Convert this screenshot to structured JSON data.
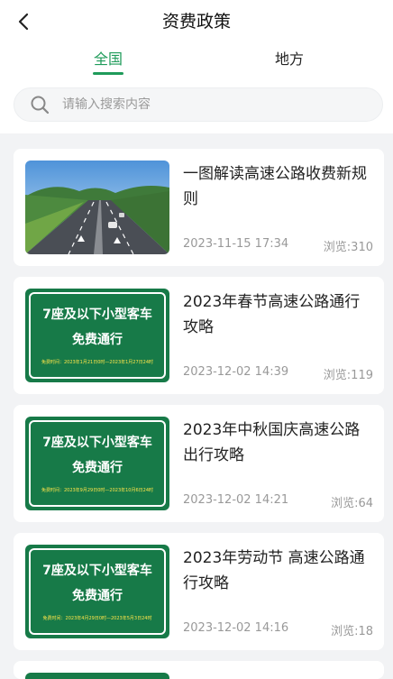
{
  "header": {
    "back_icon": "chevron-left-icon",
    "title": "资费政策"
  },
  "tabs": {
    "items": [
      {
        "label": "全国",
        "active": true
      },
      {
        "label": "地方",
        "active": false
      }
    ],
    "accent_color": "#1f9b5a"
  },
  "search": {
    "icon": "search-icon",
    "placeholder": "请输入搜索内容",
    "value": ""
  },
  "articles": [
    {
      "title": "一图解读高速公路收费新规则",
      "date": "2023-11-15 17:34",
      "views": "浏览:310",
      "thumbnail": "highway-photo"
    },
    {
      "title": "2023年春节高速公路通行攻略",
      "date": "2023-12-02 14:39",
      "views": "浏览:119",
      "thumbnail": "green-sign",
      "sign": {
        "line1": "7座及以下小型客车",
        "line2": "免费通行",
        "line3": "免费时间：2023年1月21日0时—2023年1月27日24时"
      }
    },
    {
      "title": "2023年中秋国庆高速公路出行攻略",
      "date": "2023-12-02 14:21",
      "views": "浏览:64",
      "thumbnail": "green-sign",
      "sign": {
        "line1": "7座及以下小型客车",
        "line2": "免费通行",
        "line3": "免费时间：2023年9月29日0时—2023年10月6日24时"
      }
    },
    {
      "title": "2023年劳动节 高速公路通行攻略",
      "date": "2023-12-02 14:16",
      "views": "浏览:18",
      "thumbnail": "green-sign",
      "sign": {
        "line1": "7座及以下小型客车",
        "line2": "免费通行",
        "line3": "免费时间：2023年4月29日0时—2023年5月3日24时"
      }
    }
  ]
}
